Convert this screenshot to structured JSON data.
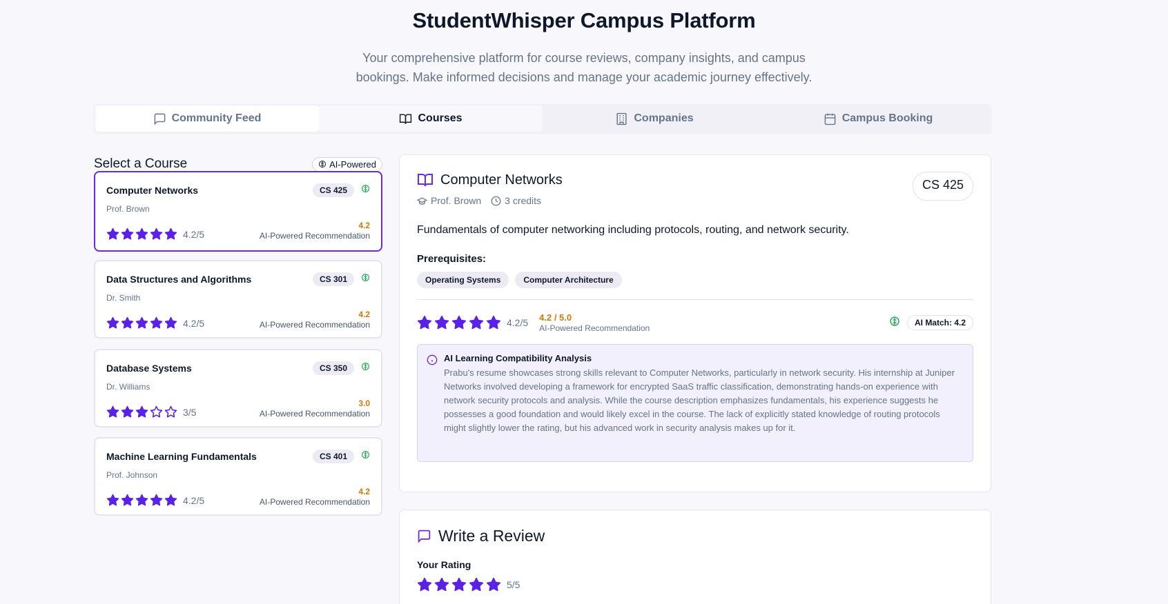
{
  "header": {
    "title": "StudentWhisper Campus Platform",
    "subtitle": "Your comprehensive platform for course reviews, company insights, and campus bookings. Make informed decisions and manage your academic journey effectively."
  },
  "tabs": [
    {
      "label": "Community Feed",
      "icon": "message-icon"
    },
    {
      "label": "Courses",
      "icon": "book-icon"
    },
    {
      "label": "Companies",
      "icon": "building-icon"
    },
    {
      "label": "Campus Booking",
      "icon": "calendar-icon"
    }
  ],
  "course_list": {
    "heading": "Select a Course",
    "badge": "AI-Powered",
    "courses": [
      {
        "name": "Computer Networks",
        "code": "CS 425",
        "prof": "Prof. Brown",
        "stars": 5,
        "rating": "4.2/5",
        "rec": "4.2",
        "rec_label": "AI-Powered Recommendation"
      },
      {
        "name": "Data Structures and Algorithms",
        "code": "CS 301",
        "prof": "Dr. Smith",
        "stars": 5,
        "rating": "4.2/5",
        "rec": "4.2",
        "rec_label": "AI-Powered Recommendation"
      },
      {
        "name": "Database Systems",
        "code": "CS 350",
        "prof": "Dr. Williams",
        "stars": 3,
        "rating": "3/5",
        "rec": "3.0",
        "rec_label": "AI-Powered Recommendation"
      },
      {
        "name": "Machine Learning Fundamentals",
        "code": "CS 401",
        "prof": "Prof. Johnson",
        "stars": 5,
        "rating": "4.2/5",
        "rec": "4.2",
        "rec_label": "AI-Powered Recommendation"
      }
    ]
  },
  "detail": {
    "title": "Computer Networks",
    "code": "CS 425",
    "prof": "Prof. Brown",
    "credits": "3 credits",
    "description": "Fundamentals of computer networking including protocols, routing, and network security.",
    "prereq_label": "Prerequisites:",
    "prereqs": [
      "Operating Systems",
      "Computer Architecture"
    ],
    "stars": 5,
    "rating": "4.2/5",
    "rec": "4.2 / 5.0",
    "rec_label": "AI-Powered Recommendation",
    "ai_match": "AI Match: 4.2",
    "analysis_title": "AI Learning Compatibility Analysis",
    "analysis_text": "Prabu's resume showcases strong skills relevant to Computer Networks, particularly in network security. His internship at Juniper Networks involved developing a framework for encrypted SaaS traffic classification, demonstrating hands-on experience with network security protocols and analysis. While the course description emphasizes fundamentals, his experience suggests he possesses a good foundation and would likely excel in the course. The lack of explicitly stated knowledge of routing protocols might slightly lower the rating, but his advanced work in security analysis makes up for it."
  },
  "review": {
    "title": "Write a Review",
    "rating_label": "Your Rating",
    "stars": 5,
    "rating": "5/5"
  },
  "colors": {
    "accent": "#6d28d9",
    "star": "#5b21e6",
    "rec": "#d97706",
    "ai": "#16a34a"
  }
}
